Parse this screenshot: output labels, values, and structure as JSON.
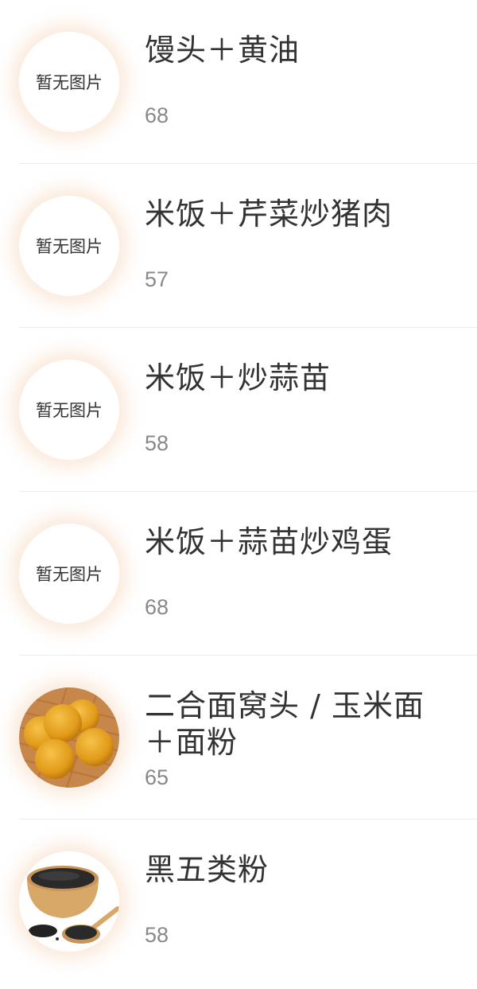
{
  "placeholder_text": "暂无图片",
  "items": [
    {
      "name": "馒头＋黄油",
      "value": "68",
      "image": "none"
    },
    {
      "name": "米饭＋芹菜炒猪肉",
      "value": "57",
      "image": "none"
    },
    {
      "name": "米饭＋炒蒜苗",
      "value": "58",
      "image": "none"
    },
    {
      "name": "米饭＋蒜苗炒鸡蛋",
      "value": "68",
      "image": "none"
    },
    {
      "name": "二合面窝头 / 玉米面＋面粉",
      "value": "65",
      "image": "cornbread-buns-photo"
    },
    {
      "name": "黑五类粉",
      "value": "58",
      "image": "black-powder-bowl-photo"
    }
  ],
  "colors": {
    "title": "#333333",
    "value": "#888888",
    "divider": "#ececec",
    "glow": "#fae2ce"
  }
}
